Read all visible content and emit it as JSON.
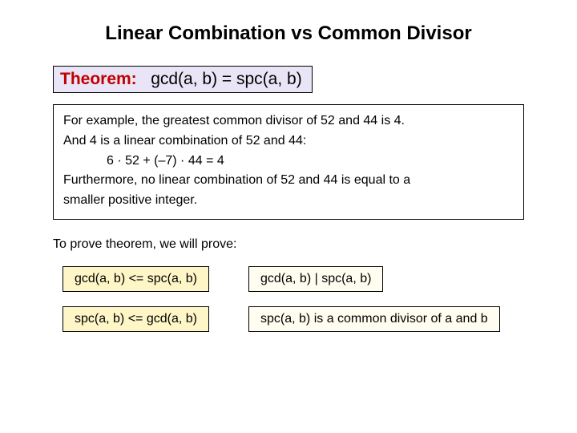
{
  "title": "Linear Combination vs Common Divisor",
  "theorem": {
    "label": "Theorem:",
    "equation": "gcd(a, b) = spc(a, b)"
  },
  "example": {
    "line1": "For example, the greatest common divisor of 52 and 44 is 4.",
    "line2": "And 4 is a linear combination of 52 and 44:",
    "calc": "6 · 52 + (–7) · 44 = 4",
    "line3": "Furthermore, no linear combination of 52 and 44 is equal to a",
    "line4": "smaller positive integer."
  },
  "prove": "To prove theorem, we will prove:",
  "boxes": {
    "left1": "gcd(a, b) <= spc(a, b)",
    "right1": "gcd(a, b) | spc(a, b)",
    "left2": "spc(a, b) <= gcd(a, b)",
    "right2": "spc(a, b) is a common divisor of a and b"
  }
}
